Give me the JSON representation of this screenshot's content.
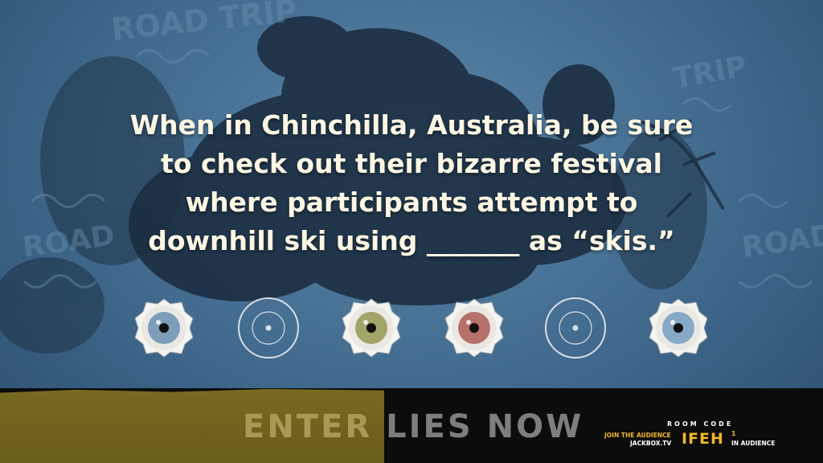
{
  "question": {
    "lines": [
      "When in Chinchilla, Australia, be sure",
      "to check out their bizarre festival",
      "where participants attempt to",
      "downhill ski using _______ as “skis.”"
    ]
  },
  "background": {
    "watermark_text": [
      "ROAD TRIP",
      "TRIP",
      "ROAD",
      "ROAD"
    ]
  },
  "players": [
    {
      "state": "submitted",
      "iris_color": "#7e9dbb",
      "icon": "eye-icon"
    },
    {
      "state": "waiting",
      "icon": "empty-ring-icon"
    },
    {
      "state": "submitted",
      "iris_color": "#a3a46a",
      "icon": "eye-icon"
    },
    {
      "state": "submitted",
      "iris_color": "#b7706b",
      "icon": "eye-icon"
    },
    {
      "state": "waiting",
      "icon": "empty-ring-icon"
    },
    {
      "state": "submitted",
      "iris_color": "#86a9c7",
      "icon": "eye-icon"
    }
  ],
  "prompt_bar": {
    "word1": "ENTER",
    "word2": "LIES NOW"
  },
  "room": {
    "label": "ROOM CODE",
    "code": "IFEH",
    "join_line1": "JOIN THE AUDIENCE",
    "join_line2": "JACKBOX.TV",
    "audience_count": "1",
    "audience_label": "IN AUDIENCE"
  },
  "colors": {
    "question_text": "#fbf6e3",
    "background_blue": "#40698c",
    "accent_gold": "#f0b72c",
    "mustard": "#786a20"
  }
}
